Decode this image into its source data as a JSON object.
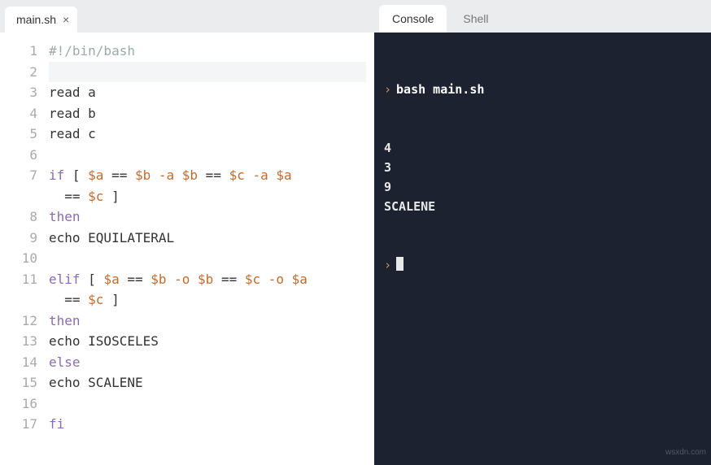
{
  "editor": {
    "tab": {
      "filename": "main.sh",
      "close_glyph": "×"
    },
    "lines": [
      {
        "n": 1,
        "segs": [
          {
            "t": "#!/bin/bash",
            "cls": "tok-comment"
          }
        ]
      },
      {
        "n": 2,
        "segs": [
          {
            "t": "",
            "cls": ""
          }
        ],
        "current": true
      },
      {
        "n": 3,
        "segs": [
          {
            "t": "read a",
            "cls": ""
          }
        ]
      },
      {
        "n": 4,
        "segs": [
          {
            "t": "read b",
            "cls": ""
          }
        ]
      },
      {
        "n": 5,
        "segs": [
          {
            "t": "read c",
            "cls": ""
          }
        ]
      },
      {
        "n": 6,
        "segs": [
          {
            "t": "",
            "cls": ""
          }
        ]
      },
      {
        "n": 7,
        "segs": [
          {
            "t": "if",
            "cls": "tok-kw"
          },
          {
            "t": " [ ",
            "cls": ""
          },
          {
            "t": "$a",
            "cls": "tok-var"
          },
          {
            "t": " == ",
            "cls": ""
          },
          {
            "t": "$b",
            "cls": "tok-var"
          },
          {
            "t": " ",
            "cls": ""
          },
          {
            "t": "-a",
            "cls": "tok-flag"
          },
          {
            "t": " ",
            "cls": ""
          },
          {
            "t": "$b",
            "cls": "tok-var"
          },
          {
            "t": " == ",
            "cls": ""
          },
          {
            "t": "$c",
            "cls": "tok-var"
          },
          {
            "t": " ",
            "cls": ""
          },
          {
            "t": "-a",
            "cls": "tok-flag"
          },
          {
            "t": " ",
            "cls": ""
          },
          {
            "t": "$a",
            "cls": "tok-var"
          }
        ]
      },
      {
        "n": null,
        "cont": true,
        "segs": [
          {
            "t": "== ",
            "cls": ""
          },
          {
            "t": "$c",
            "cls": "tok-var"
          },
          {
            "t": " ]",
            "cls": ""
          }
        ]
      },
      {
        "n": 8,
        "segs": [
          {
            "t": "then",
            "cls": "tok-kw"
          }
        ]
      },
      {
        "n": 9,
        "segs": [
          {
            "t": "echo",
            "cls": ""
          },
          {
            "t": " EQUILATERAL",
            "cls": ""
          }
        ]
      },
      {
        "n": 10,
        "segs": [
          {
            "t": "",
            "cls": ""
          }
        ]
      },
      {
        "n": 11,
        "segs": [
          {
            "t": "elif",
            "cls": "tok-kw"
          },
          {
            "t": " [ ",
            "cls": ""
          },
          {
            "t": "$a",
            "cls": "tok-var"
          },
          {
            "t": " == ",
            "cls": ""
          },
          {
            "t": "$b",
            "cls": "tok-var"
          },
          {
            "t": " ",
            "cls": ""
          },
          {
            "t": "-o",
            "cls": "tok-flag"
          },
          {
            "t": " ",
            "cls": ""
          },
          {
            "t": "$b",
            "cls": "tok-var"
          },
          {
            "t": " == ",
            "cls": ""
          },
          {
            "t": "$c",
            "cls": "tok-var"
          },
          {
            "t": " ",
            "cls": ""
          },
          {
            "t": "-o",
            "cls": "tok-flag"
          },
          {
            "t": " ",
            "cls": ""
          },
          {
            "t": "$a",
            "cls": "tok-var"
          }
        ]
      },
      {
        "n": null,
        "cont": true,
        "segs": [
          {
            "t": "== ",
            "cls": ""
          },
          {
            "t": "$c",
            "cls": "tok-var"
          },
          {
            "t": " ]",
            "cls": ""
          }
        ]
      },
      {
        "n": 12,
        "segs": [
          {
            "t": "then",
            "cls": "tok-kw"
          }
        ]
      },
      {
        "n": 13,
        "segs": [
          {
            "t": "echo",
            "cls": ""
          },
          {
            "t": " ISOSCELES",
            "cls": ""
          }
        ]
      },
      {
        "n": 14,
        "segs": [
          {
            "t": "else",
            "cls": "tok-kw"
          }
        ]
      },
      {
        "n": 15,
        "segs": [
          {
            "t": "echo",
            "cls": ""
          },
          {
            "t": " SCALENE",
            "cls": ""
          }
        ]
      },
      {
        "n": 16,
        "segs": [
          {
            "t": "",
            "cls": ""
          }
        ]
      },
      {
        "n": 17,
        "segs": [
          {
            "t": "fi",
            "cls": "tok-kw"
          }
        ]
      }
    ]
  },
  "right": {
    "tabs": {
      "console": "Console",
      "shell": "Shell"
    },
    "prompt_glyph": "›",
    "command": "bash main.sh",
    "output": [
      "4",
      "3",
      "9",
      "SCALENE"
    ]
  },
  "watermark": "wsxdn.com"
}
